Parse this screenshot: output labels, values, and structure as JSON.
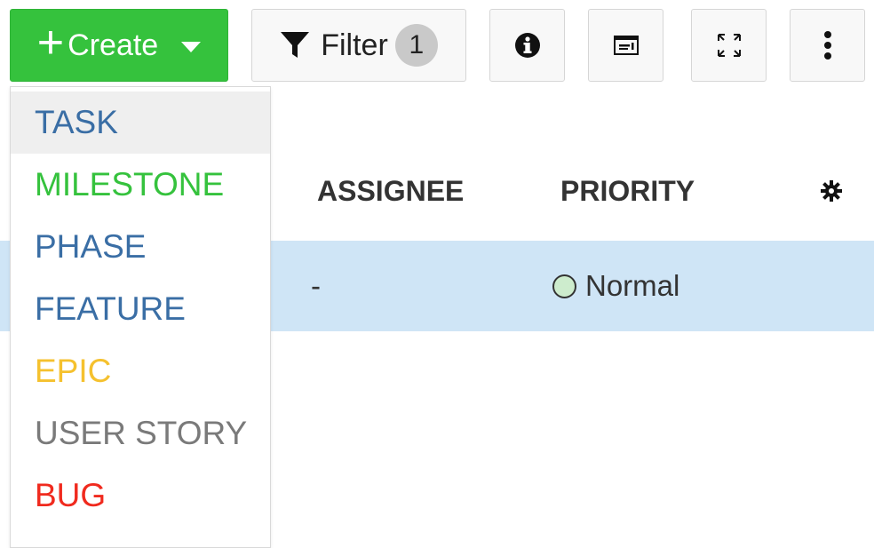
{
  "toolbar": {
    "create_label": "Create",
    "filter_label": "Filter",
    "filter_count": "1"
  },
  "create_menu": {
    "items": [
      {
        "label": "TASK",
        "color": "#3a6ea5"
      },
      {
        "label": "MILESTONE",
        "color": "#35c23d"
      },
      {
        "label": "PHASE",
        "color": "#3a6ea5"
      },
      {
        "label": "FEATURE",
        "color": "#3a6ea5"
      },
      {
        "label": "EPIC",
        "color": "#f5c12e"
      },
      {
        "label": "USER STORY",
        "color": "#7a7a7a"
      },
      {
        "label": "BUG",
        "color": "#f02a1e"
      }
    ]
  },
  "table": {
    "columns": {
      "assignee": "ASSIGNEE",
      "priority": "PRIORITY"
    },
    "rows": [
      {
        "assignee": "-",
        "priority": "Normal"
      }
    ]
  },
  "icons": {
    "create": "plus-icon",
    "create_caret": "caret-down-icon",
    "filter": "filter-funnel-icon",
    "info": "info-circle-icon",
    "layout": "layout-icon",
    "expand": "expand-arrows-icon",
    "more": "vertical-ellipsis-icon",
    "settings": "gear-icon",
    "priority": "circle-icon"
  },
  "colors": {
    "create_button": "#35c23d",
    "selected_row": "#cfe5f6",
    "priority_normal": "#cdeccd"
  }
}
